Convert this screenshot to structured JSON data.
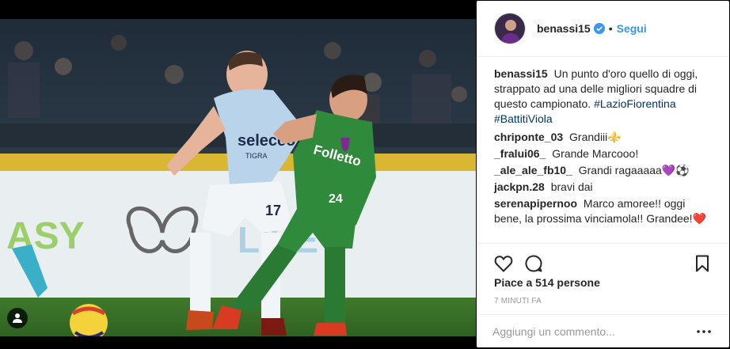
{
  "post": {
    "username": "benassi15",
    "follow_label": "Segui",
    "dot": "•",
    "caption": {
      "username": "benassi15",
      "text": "Un punto d'oro quello di oggi, strappato ad una delle migliori squadre di questo campionato.",
      "hashtag_1": "#LazioFiorentina",
      "hashtag_2": "#BattitiViola"
    },
    "comments": [
      {
        "user": "chriponte_03",
        "text": "Grandiii⚜️"
      },
      {
        "user": "_fralui06_",
        "text": "Grande Marcooo!"
      },
      {
        "user": "_ale_ale_fb10_",
        "text": "Grandi ragaaaaa💜⚽"
      },
      {
        "user": "jackpn.28",
        "text": "bravi dai"
      },
      {
        "user": "serenapipernoo",
        "text": "Marco amoree!! oggi bene, la prossima vinciamola!! Grandee!❤️"
      }
    ],
    "likes": "Piace a 514 persone",
    "time": "7 minuti fa",
    "add_comment_placeholder": "Aggiungi un commento...",
    "photo": {
      "ad_text_left": "ASY",
      "ad_text_right": "LIVE",
      "sponsor_lazio": "selecco",
      "sponsor_lazio_sub": "TIGRA",
      "sponsor_fiorentina": "Folletto",
      "number_lazio": "17",
      "number_fiorentina": "24"
    },
    "colors": {
      "link": "#3897f0",
      "hashtag": "#003569",
      "lazio_kit": "#b9d4ea",
      "fiorentina_kit": "#2f8a3c"
    },
    "icons": [
      "verified-icon",
      "heart-icon",
      "comment-icon",
      "bookmark-icon",
      "more-icon",
      "user-tag-icon"
    ]
  }
}
